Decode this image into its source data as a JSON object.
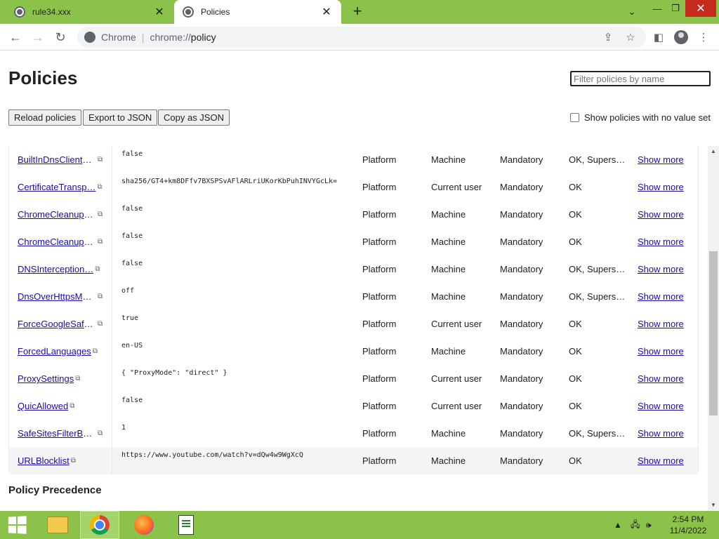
{
  "tabs": [
    {
      "title": "rule34.xxx",
      "active": false
    },
    {
      "title": "Policies",
      "active": true
    }
  ],
  "toolbar": {
    "site_label": "Chrome",
    "url_prefix": "chrome://",
    "url_path": "policy"
  },
  "page": {
    "title": "Policies",
    "filter_placeholder": "Filter policies by name",
    "buttons": {
      "reload": "Reload policies",
      "export": "Export to JSON",
      "copy": "Copy as JSON"
    },
    "show_no_value_label": "Show policies with no value set",
    "show_no_value_checked": false
  },
  "policies": [
    {
      "name": "BuiltInDnsClientE…",
      "value": "false",
      "source": "Platform",
      "scope": "Machine",
      "level": "Mandatory",
      "status": "OK, Supers…",
      "more": "Show more"
    },
    {
      "name": "CertificateTransp…",
      "value": "sha256/GT4+km8DFfv7BXSPSvAFlARLriUKorKbPuhINVYGcLk=",
      "source": "Platform",
      "scope": "Current user",
      "level": "Mandatory",
      "status": "OK",
      "more": "Show more"
    },
    {
      "name": "ChromeCleanupE…",
      "value": "false",
      "source": "Platform",
      "scope": "Machine",
      "level": "Mandatory",
      "status": "OK",
      "more": "Show more"
    },
    {
      "name": "ChromeCleanupR…",
      "value": "false",
      "source": "Platform",
      "scope": "Machine",
      "level": "Mandatory",
      "status": "OK",
      "more": "Show more"
    },
    {
      "name": "DNSInterception…",
      "value": "false",
      "source": "Platform",
      "scope": "Machine",
      "level": "Mandatory",
      "status": "OK, Supers…",
      "more": "Show more"
    },
    {
      "name": "DnsOverHttpsMo…",
      "value": "off",
      "source": "Platform",
      "scope": "Machine",
      "level": "Mandatory",
      "status": "OK, Supers…",
      "more": "Show more"
    },
    {
      "name": "ForceGoogleSafe…",
      "value": "true",
      "source": "Platform",
      "scope": "Current user",
      "level": "Mandatory",
      "status": "OK",
      "more": "Show more"
    },
    {
      "name": "ForcedLanguages",
      "value": "en-US",
      "source": "Platform",
      "scope": "Machine",
      "level": "Mandatory",
      "status": "OK",
      "more": "Show more"
    },
    {
      "name": "ProxySettings",
      "value": "{ \"ProxyMode\": \"direct\" }",
      "source": "Platform",
      "scope": "Current user",
      "level": "Mandatory",
      "status": "OK",
      "more": "Show more"
    },
    {
      "name": "QuicAllowed",
      "value": "false",
      "source": "Platform",
      "scope": "Current user",
      "level": "Mandatory",
      "status": "OK",
      "more": "Show more"
    },
    {
      "name": "SafeSitesFilterBe…",
      "value": "1",
      "source": "Platform",
      "scope": "Machine",
      "level": "Mandatory",
      "status": "OK, Supers…",
      "more": "Show more"
    },
    {
      "name": "URLBlocklist",
      "value": "https://www.youtube.com/watch?v=dQw4w9WgXcQ",
      "source": "Platform",
      "scope": "Machine",
      "level": "Mandatory",
      "status": "OK",
      "more": "Show more"
    }
  ],
  "section": {
    "precedence_title": "Policy Precedence"
  },
  "taskbar": {
    "time": "2:54 PM",
    "date": "11/4/2022"
  },
  "colors": {
    "frame": "#8bc34a",
    "link": "#1a0dab",
    "close_button": "#c42b1c"
  }
}
